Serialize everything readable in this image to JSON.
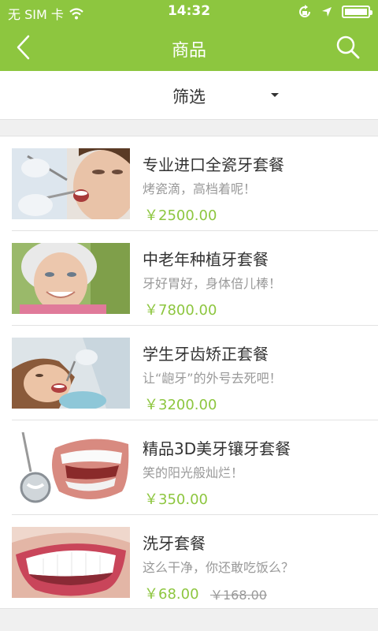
{
  "status": {
    "carrier": "无 SIM 卡",
    "time": "14:32"
  },
  "header": {
    "title": "商品",
    "color": "#8dc63f"
  },
  "filter": {
    "label": "筛选"
  },
  "products": [
    {
      "title": "专业进口全瓷牙套餐",
      "subtitle": "烤瓷滴，高档着呢！",
      "price": "￥2500.00",
      "image": "dentist-exam-photo"
    },
    {
      "title": "中老年种植牙套餐",
      "subtitle": "牙好胃好，身体倍儿棒！",
      "price": "￥7800.00",
      "image": "elderly-woman-smile-photo"
    },
    {
      "title": "学生牙齿矫正套餐",
      "subtitle": "让“龅牙”的外号去死吧！",
      "price": "￥3200.00",
      "image": "girl-dental-chair-photo"
    },
    {
      "title": "精品3D美牙镶牙套餐",
      "subtitle": "笑的阳光般灿烂！",
      "price": "￥350.00",
      "image": "teeth-with-mirror-photo"
    },
    {
      "title": "洗牙套餐",
      "subtitle": "这么干净，你还敢吃饭么？",
      "price": "￥68.00",
      "old_price": "￥168.00",
      "image": "white-teeth-smile-photo"
    }
  ]
}
